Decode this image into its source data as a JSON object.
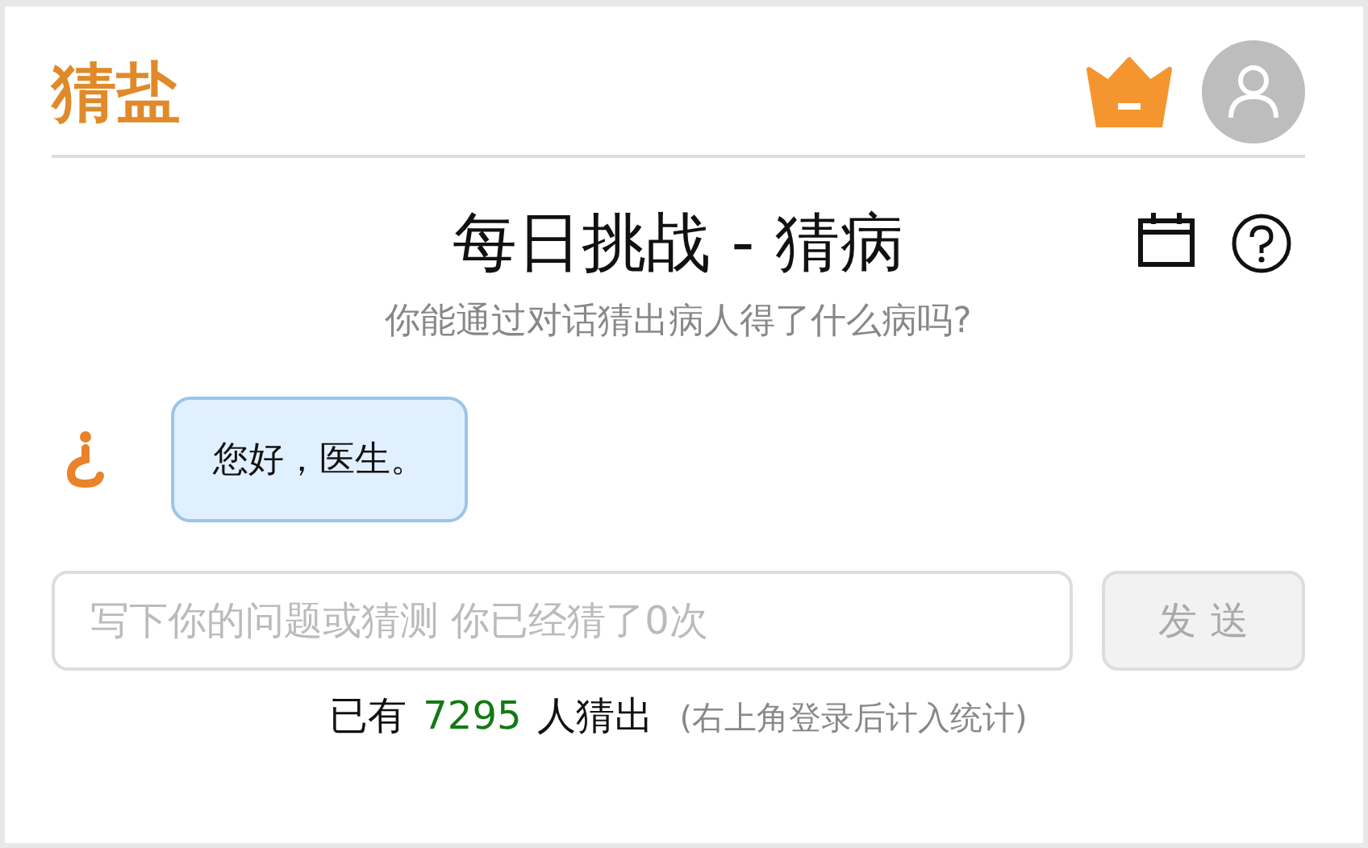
{
  "header": {
    "logo": "猜盐"
  },
  "challenge": {
    "title": "每日挑战 - 猜病",
    "subtitle": "你能通过对话猜出病人得了什么病吗?"
  },
  "messages": [
    {
      "text": "您好，医生。"
    }
  ],
  "input": {
    "placeholder": "写下你的问题或猜测 你已经猜了0次"
  },
  "send_button": {
    "label": "发 送",
    "disabled": true
  },
  "stats": {
    "prefix": "已有",
    "count": "7295",
    "suffix": "人猜出",
    "note": "(右上角登录后计入统计)"
  }
}
